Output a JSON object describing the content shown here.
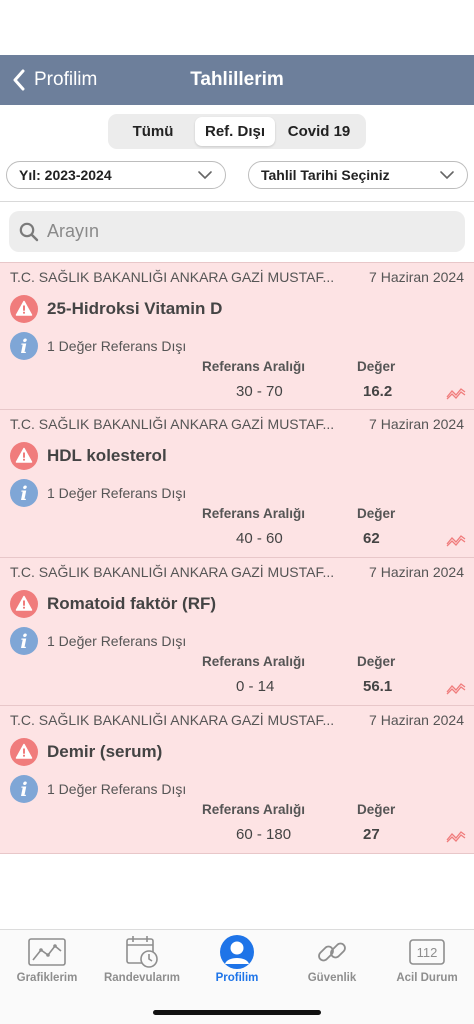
{
  "navbar": {
    "back_label": "Profilim",
    "title": "Tahlillerim"
  },
  "segments": [
    {
      "label": "Tümü",
      "active": false
    },
    {
      "label": "Ref. Dışı",
      "active": true
    },
    {
      "label": "Covid 19",
      "active": false
    }
  ],
  "filters": {
    "year": "Yıl: 2023-2024",
    "date": "Tahlil Tarihi Seçiniz"
  },
  "search": {
    "placeholder": "Arayın"
  },
  "columns": {
    "range_header": "Referans Aralığı",
    "value_header": "Değer"
  },
  "results": [
    {
      "lab": "T.C. SAĞLIK BAKANLIĞI ANKARA GAZİ MUSTAF...",
      "date": "7 Haziran 2024",
      "name": "25-Hidroksi Vitamin D",
      "info": "1 Değer Referans Dışı",
      "range": "30 - 70",
      "value": "16.2"
    },
    {
      "lab": "T.C. SAĞLIK BAKANLIĞI ANKARA GAZİ MUSTAF...",
      "date": "7 Haziran 2024",
      "name": "HDL kolesterol",
      "info": "1 Değer Referans Dışı",
      "range": "40 - 60",
      "value": "62"
    },
    {
      "lab": "T.C. SAĞLIK BAKANLIĞI ANKARA GAZİ MUSTAF...",
      "date": "7 Haziran 2024",
      "name": "Romatoid faktör (RF)",
      "info": "1 Değer Referans Dışı",
      "range": "0 - 14",
      "value": "56.1"
    },
    {
      "lab": "T.C. SAĞLIK BAKANLIĞI ANKARA GAZİ MUSTAF...",
      "date": "7 Haziran 2024",
      "name": "Demir (serum)",
      "info": "1 Değer Referans Dışı",
      "range": "60 - 180",
      "value": "27"
    }
  ],
  "tabs": [
    {
      "label": "Grafiklerim",
      "icon": "chart-icon",
      "active": false
    },
    {
      "label": "Randevularım",
      "icon": "calendar-clock-icon",
      "active": false
    },
    {
      "label": "Profilim",
      "icon": "person-icon",
      "active": true
    },
    {
      "label": "Güvenlik",
      "icon": "link-icon",
      "active": false
    },
    {
      "label": "Acil Durum",
      "icon": "emergency-112-icon",
      "active": false
    }
  ],
  "emergency_badge": "112",
  "colors": {
    "navbar": "#6d7f9b",
    "card_bg": "#fde3e4",
    "warning": "#f07c7c",
    "info": "#7fa6d6",
    "active_tab": "#1e74e8"
  }
}
